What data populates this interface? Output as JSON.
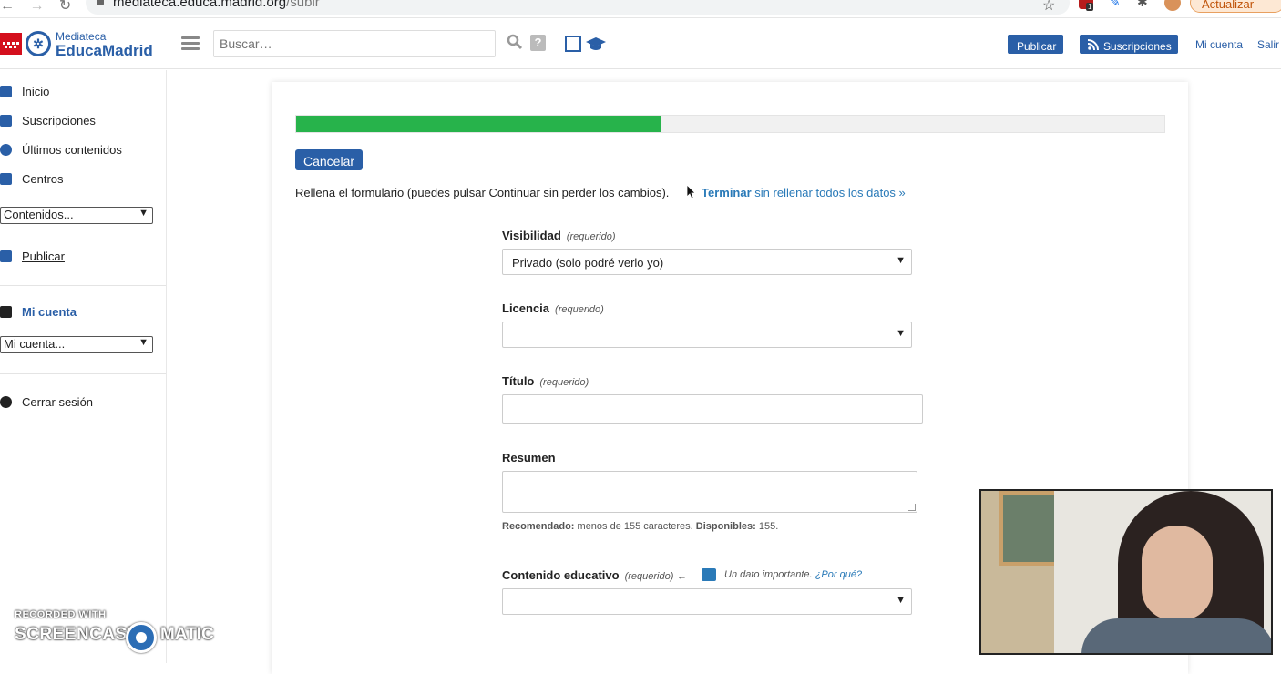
{
  "browser": {
    "url_host": "mediateca.educa.madrid.org",
    "url_path": "/subir",
    "update_label": "Actualizar",
    "ext_badge": "1"
  },
  "header": {
    "logo_small": "Mediateca",
    "logo_big": "EducaMadrid",
    "search_placeholder": "Buscar…",
    "help_icon": "?",
    "publicar_label": "Publicar",
    "suscripciones_label": "Suscripciones",
    "mi_cuenta_label": "Mi cuenta",
    "salir_label": "Salir"
  },
  "sidebar": {
    "items": [
      {
        "label": "Inicio",
        "icon": "home-icon"
      },
      {
        "label": "Suscripciones",
        "icon": "rss-icon"
      },
      {
        "label": "Últimos contenidos",
        "icon": "clock-icon"
      },
      {
        "label": "Centros",
        "icon": "building-icon"
      }
    ],
    "contenidos_select": "Contenidos...",
    "publicar_label": "Publicar",
    "mi_cuenta_title": "Mi cuenta",
    "mi_cuenta_select": "Mi cuenta...",
    "cerrar_label": "Cerrar sesión"
  },
  "upload": {
    "progress_fraction": 0.42,
    "cancel_label": "Cancelar",
    "instruction": "Rellena el formulario (puedes pulsar Continuar sin perder los cambios).",
    "finish_bold": "Terminar",
    "finish_rest": " sin rellenar todos los datos »",
    "visibilidad_label": "Visibilidad",
    "required": "(requerido)",
    "visibilidad_value": "Privado (solo podré verlo yo)",
    "licencia_label": "Licencia",
    "licencia_value": "",
    "titulo_label": "Título",
    "resumen_label": "Resumen",
    "hint_rec": "Recomendado:",
    "hint_text": " menos de 155 caracteres. ",
    "hint_disp": "Disponibles:",
    "hint_count": " 155.",
    "edu_label": "Contenido educativo",
    "edu_arrow": "←",
    "edu_note": "Un dato importante.",
    "edu_why": "¿Por qué?",
    "edu_value": ""
  },
  "watermark": {
    "recorded": "RECORDED WITH",
    "brand": "SCREENCAST",
    "matic": "MATIC"
  },
  "colors": {
    "accent": "#2a5fa7",
    "progress": "#27b34b",
    "link": "#2a7ab8"
  }
}
